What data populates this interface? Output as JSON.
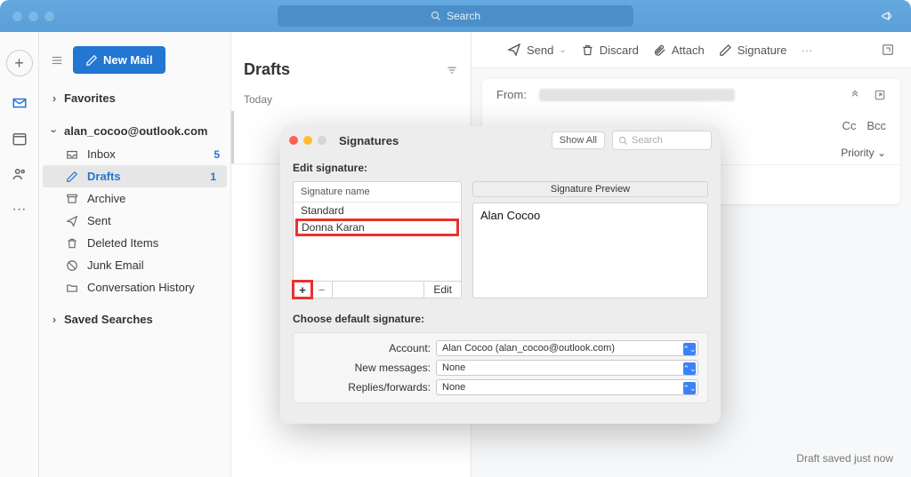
{
  "titlebar": {
    "search_placeholder": "Search"
  },
  "sidebar": {
    "new_mail": "New Mail",
    "favorites": "Favorites",
    "account": "alan_cocoo@outlook.com",
    "items": [
      {
        "label": "Inbox",
        "badge": "5"
      },
      {
        "label": "Drafts",
        "badge": "1"
      },
      {
        "label": "Archive"
      },
      {
        "label": "Sent"
      },
      {
        "label": "Deleted Items"
      },
      {
        "label": "Junk Email"
      },
      {
        "label": "Conversation History"
      }
    ],
    "saved_searches": "Saved Searches"
  },
  "middle": {
    "title": "Drafts",
    "today": "Today"
  },
  "compose": {
    "send": "Send",
    "discard": "Discard",
    "attach": "Attach",
    "signature": "Signature",
    "from_label": "From:",
    "priority": "Priority",
    "cc": "Cc",
    "bcc": "Bcc",
    "saved": "Draft saved just now"
  },
  "sig": {
    "title": "Signatures",
    "show_all": "Show All",
    "search_placeholder": "Search",
    "edit_label": "Edit signature:",
    "col_header": "Signature name",
    "names": [
      "Standard",
      "Donna Karan"
    ],
    "edit_btn": "Edit",
    "preview_header": "Signature Preview",
    "preview_text": "Alan Cocoo",
    "defaults_label": "Choose default signature:",
    "account_label": "Account:",
    "account_value": "Alan Cocoo (alan_cocoo@outlook.com)",
    "new_label": "New messages:",
    "new_value": "None",
    "reply_label": "Replies/forwards:",
    "reply_value": "None"
  }
}
